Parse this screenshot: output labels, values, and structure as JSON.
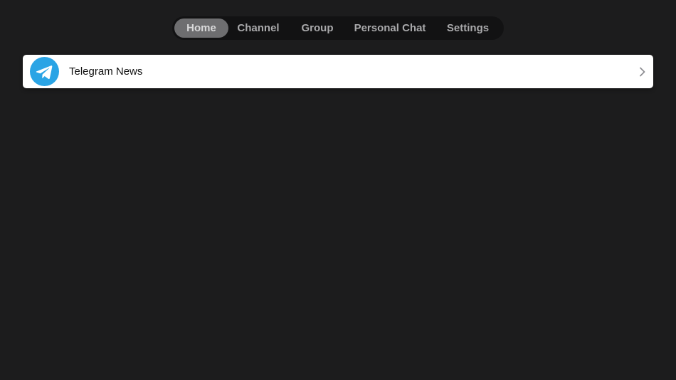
{
  "tabs": [
    {
      "label": "Home",
      "active": true
    },
    {
      "label": "Channel",
      "active": false
    },
    {
      "label": "Group",
      "active": false
    },
    {
      "label": "Personal Chat",
      "active": false
    },
    {
      "label": "Settings",
      "active": false
    }
  ],
  "list": {
    "items": [
      {
        "title": "Telegram News",
        "icon": "telegram-icon",
        "trailing_icon": "chevron-right-icon"
      }
    ]
  },
  "colors": {
    "background": "#1c1c1d",
    "tabbar": "#121213",
    "tab_active": "#6e6e70",
    "telegram_blue": "#2aa4e5",
    "row_background": "#ffffff"
  }
}
